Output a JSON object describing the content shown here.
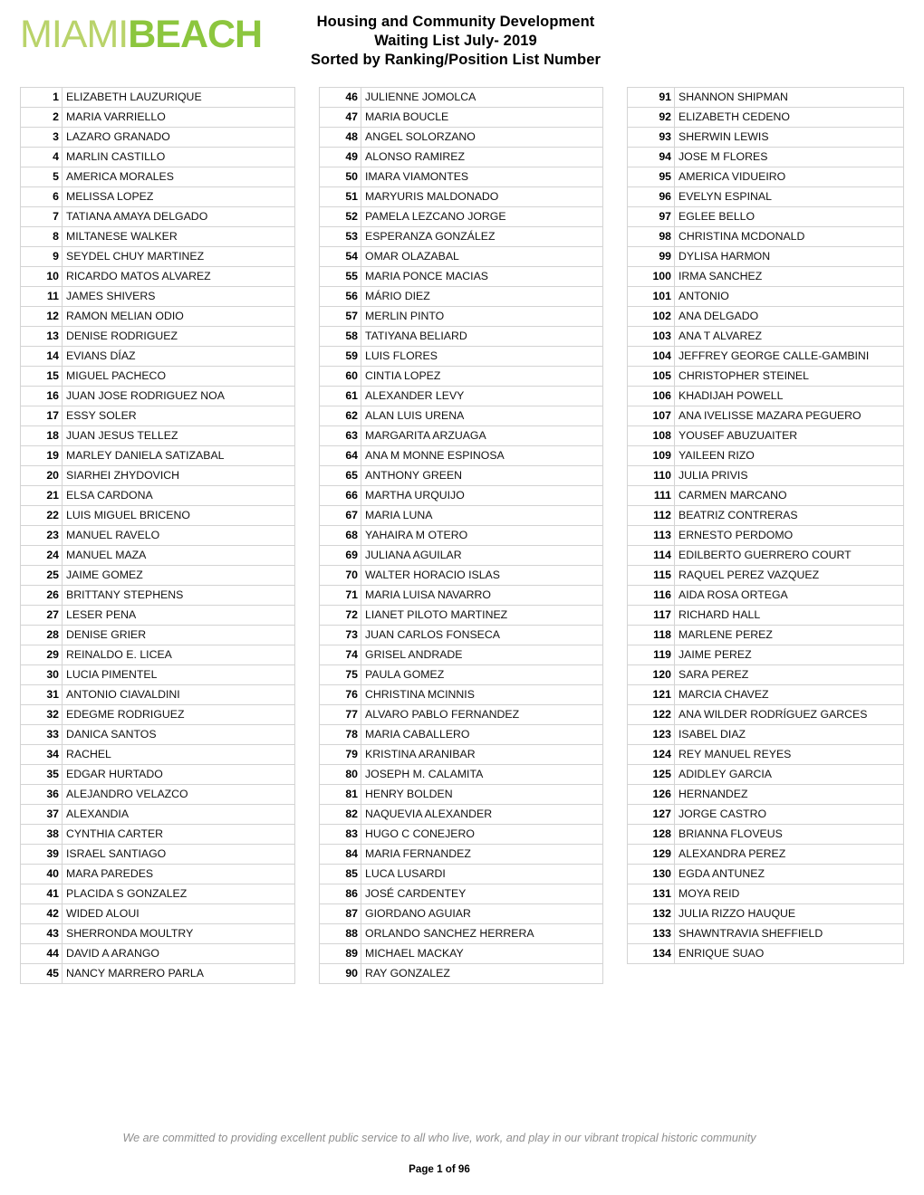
{
  "header": {
    "logo": {
      "part1": "MIAMI",
      "part2": "BEACH",
      "color1": "#b9d36a",
      "color2": "#8cc63e"
    },
    "title_lines": [
      "Housing and Community Development",
      "Waiting List July- 2019",
      "Sorted by Ranking/Position List Number"
    ]
  },
  "footer": {
    "tagline": "We are committed to providing excellent public service to all who live, work, and play in our vibrant tropical historic community",
    "page": "Page 1 of 96"
  },
  "columns": [
    {
      "rows": [
        {
          "num": "1",
          "name": "ELIZABETH LAUZURIQUE"
        },
        {
          "num": "2",
          "name": "MARIA VARRIELLO"
        },
        {
          "num": "3",
          "name": "LAZARO GRANADO"
        },
        {
          "num": "4",
          "name": "MARLIN CASTILLO"
        },
        {
          "num": "5",
          "name": "AMERICA MORALES"
        },
        {
          "num": "6",
          "name": "MELISSA LOPEZ"
        },
        {
          "num": "7",
          "name": "TATIANA AMAYA DELGADO"
        },
        {
          "num": "8",
          "name": "MILTANESE WALKER"
        },
        {
          "num": "9",
          "name": "SEYDEL CHUY MARTINEZ"
        },
        {
          "num": "10",
          "name": "RICARDO MATOS ALVAREZ"
        },
        {
          "num": "11",
          "name": "JAMES SHIVERS"
        },
        {
          "num": "12",
          "name": "RAMON MELIAN ODIO"
        },
        {
          "num": "13",
          "name": "DENISE RODRIGUEZ"
        },
        {
          "num": "14",
          "name": "EVIANS DÍAZ"
        },
        {
          "num": "15",
          "name": "MIGUEL PACHECO"
        },
        {
          "num": "16",
          "name": "JUAN JOSE RODRIGUEZ NOA"
        },
        {
          "num": "17",
          "name": "ESSY SOLER"
        },
        {
          "num": "18",
          "name": "JUAN JESUS TELLEZ"
        },
        {
          "num": "19",
          "name": "MARLEY DANIELA SATIZABAL"
        },
        {
          "num": "20",
          "name": "SIARHEI ZHYDOVICH"
        },
        {
          "num": "21",
          "name": "ELSA CARDONA"
        },
        {
          "num": "22",
          "name": "LUIS MIGUEL BRICENO"
        },
        {
          "num": "23",
          "name": "MANUEL RAVELO"
        },
        {
          "num": "24",
          "name": "MANUEL MAZA"
        },
        {
          "num": "25",
          "name": "JAIME GOMEZ"
        },
        {
          "num": "26",
          "name": "BRITTANY STEPHENS"
        },
        {
          "num": "27",
          "name": "LESER PENA"
        },
        {
          "num": "28",
          "name": "DENISE GRIER"
        },
        {
          "num": "29",
          "name": "REINALDO E. LICEA"
        },
        {
          "num": "30",
          "name": "LUCIA PIMENTEL"
        },
        {
          "num": "31",
          "name": "ANTONIO CIAVALDINI"
        },
        {
          "num": "32",
          "name": "EDEGME RODRIGUEZ"
        },
        {
          "num": "33",
          "name": "DANICA SANTOS"
        },
        {
          "num": "34",
          "name": "RACHEL"
        },
        {
          "num": "35",
          "name": "EDGAR HURTADO"
        },
        {
          "num": "36",
          "name": "ALEJANDRO VELAZCO"
        },
        {
          "num": "37",
          "name": "ALEXANDIA"
        },
        {
          "num": "38",
          "name": "CYNTHIA CARTER"
        },
        {
          "num": "39",
          "name": "ISRAEL SANTIAGO"
        },
        {
          "num": "40",
          "name": "MARA PAREDES"
        },
        {
          "num": "41",
          "name": "PLACIDA S GONZALEZ"
        },
        {
          "num": "42",
          "name": "WIDED ALOUI"
        },
        {
          "num": "43",
          "name": "SHERRONDA MOULTRY"
        },
        {
          "num": "44",
          "name": "DAVID A ARANGO"
        },
        {
          "num": "45",
          "name": "NANCY MARRERO PARLA"
        }
      ]
    },
    {
      "rows": [
        {
          "num": "46",
          "name": "JULIENNE JOMOLCA"
        },
        {
          "num": "47",
          "name": "MARIA BOUCLE"
        },
        {
          "num": "48",
          "name": "ANGEL SOLORZANO"
        },
        {
          "num": "49",
          "name": "ALONSO RAMIREZ"
        },
        {
          "num": "50",
          "name": "IMARA VIAMONTES"
        },
        {
          "num": "51",
          "name": "MARYURIS MALDONADO"
        },
        {
          "num": "52",
          "name": "PAMELA LEZCANO JORGE"
        },
        {
          "num": "53",
          "name": "ESPERANZA GONZÁLEZ"
        },
        {
          "num": "54",
          "name": "OMAR OLAZABAL"
        },
        {
          "num": "55",
          "name": "MARIA PONCE MACIAS"
        },
        {
          "num": "56",
          "name": "MÁRIO DIEZ"
        },
        {
          "num": "57",
          "name": "MERLIN PINTO"
        },
        {
          "num": "58",
          "name": "TATIYANA BELIARD"
        },
        {
          "num": "59",
          "name": "LUIS FLORES"
        },
        {
          "num": "60",
          "name": "CINTIA LOPEZ"
        },
        {
          "num": "61",
          "name": "ALEXANDER LEVY"
        },
        {
          "num": "62",
          "name": "ALAN LUIS URENA"
        },
        {
          "num": "63",
          "name": "MARGARITA ARZUAGA"
        },
        {
          "num": "64",
          "name": "ANA M MONNE ESPINOSA"
        },
        {
          "num": "65",
          "name": "ANTHONY GREEN"
        },
        {
          "num": "66",
          "name": "MARTHA URQUIJO"
        },
        {
          "num": "67",
          "name": "MARIA LUNA"
        },
        {
          "num": "68",
          "name": "YAHAIRA M OTERO"
        },
        {
          "num": "69",
          "name": "JULIANA AGUILAR"
        },
        {
          "num": "70",
          "name": "WALTER HORACIO ISLAS"
        },
        {
          "num": "71",
          "name": "MARIA LUISA NAVARRO"
        },
        {
          "num": "72",
          "name": "LIANET PILOTO MARTINEZ"
        },
        {
          "num": "73",
          "name": "JUAN CARLOS FONSECA"
        },
        {
          "num": "74",
          "name": "GRISEL ANDRADE"
        },
        {
          "num": "75",
          "name": "PAULA GOMEZ"
        },
        {
          "num": "76",
          "name": "CHRISTINA MCINNIS"
        },
        {
          "num": "77",
          "name": "ALVARO PABLO FERNANDEZ"
        },
        {
          "num": "78",
          "name": "MARIA CABALLERO"
        },
        {
          "num": "79",
          "name": "KRISTINA ARANIBAR"
        },
        {
          "num": "80",
          "name": "JOSEPH M. CALAMITA"
        },
        {
          "num": "81",
          "name": "HENRY BOLDEN"
        },
        {
          "num": "82",
          "name": "NAQUEVIA ALEXANDER"
        },
        {
          "num": "83",
          "name": "HUGO C CONEJERO"
        },
        {
          "num": "84",
          "name": "MARIA FERNANDEZ"
        },
        {
          "num": "85",
          "name": "LUCA LUSARDI"
        },
        {
          "num": "86",
          "name": "JOSÉ CARDENTEY"
        },
        {
          "num": "87",
          "name": "GIORDANO AGUIAR"
        },
        {
          "num": "88",
          "name": "ORLANDO SANCHEZ HERRERA"
        },
        {
          "num": "89",
          "name": "MICHAEL MACKAY"
        },
        {
          "num": "90",
          "name": "RAY GONZALEZ"
        }
      ]
    },
    {
      "rows": [
        {
          "num": "91",
          "name": "SHANNON SHIPMAN"
        },
        {
          "num": "92",
          "name": "ELIZABETH CEDENO"
        },
        {
          "num": "93",
          "name": "SHERWIN LEWIS"
        },
        {
          "num": "94",
          "name": "JOSE M FLORES"
        },
        {
          "num": "95",
          "name": "AMERICA VIDUEIRO"
        },
        {
          "num": "96",
          "name": "EVELYN ESPINAL"
        },
        {
          "num": "97",
          "name": "EGLEE BELLO"
        },
        {
          "num": "98",
          "name": "CHRISTINA MCDONALD"
        },
        {
          "num": "99",
          "name": "DYLISA HARMON"
        },
        {
          "num": "100",
          "name": "IRMA SANCHEZ"
        },
        {
          "num": "101",
          "name": "ANTONIO"
        },
        {
          "num": "102",
          "name": "ANA DELGADO"
        },
        {
          "num": "103",
          "name": "ANA T ALVAREZ"
        },
        {
          "num": "104",
          "name": "JEFFREY GEORGE CALLE-GAMBINI"
        },
        {
          "num": "105",
          "name": "CHRISTOPHER STEINEL"
        },
        {
          "num": "106",
          "name": "KHADIJAH POWELL"
        },
        {
          "num": "107",
          "name": "ANA IVELISSE MAZARA PEGUERO"
        },
        {
          "num": "108",
          "name": "YOUSEF ABUZUAITER"
        },
        {
          "num": "109",
          "name": "YAILEEN RIZO"
        },
        {
          "num": "110",
          "name": "JULIA PRIVIS"
        },
        {
          "num": "111",
          "name": "CARMEN MARCANO"
        },
        {
          "num": "112",
          "name": "BEATRIZ CONTRERAS"
        },
        {
          "num": "113",
          "name": "ERNESTO PERDOMO"
        },
        {
          "num": "114",
          "name": "EDILBERTO GUERRERO COURT"
        },
        {
          "num": "115",
          "name": "RAQUEL PEREZ VAZQUEZ"
        },
        {
          "num": "116",
          "name": "AIDA ROSA ORTEGA"
        },
        {
          "num": "117",
          "name": "RICHARD HALL"
        },
        {
          "num": "118",
          "name": "MARLENE PEREZ"
        },
        {
          "num": "119",
          "name": "JAIME PEREZ"
        },
        {
          "num": "120",
          "name": "SARA PEREZ"
        },
        {
          "num": "121",
          "name": "MARCIA CHAVEZ"
        },
        {
          "num": "122",
          "name": "ANA WILDER RODRÍGUEZ GARCES"
        },
        {
          "num": "123",
          "name": "ISABEL DIAZ"
        },
        {
          "num": "124",
          "name": "REY MANUEL REYES"
        },
        {
          "num": "125",
          "name": "ADIDLEY GARCIA"
        },
        {
          "num": "126",
          "name": "HERNANDEZ"
        },
        {
          "num": "127",
          "name": "JORGE CASTRO"
        },
        {
          "num": "128",
          "name": "BRIANNA FLOVEUS"
        },
        {
          "num": "129",
          "name": "ALEXANDRA PEREZ"
        },
        {
          "num": "130",
          "name": "EGDA ANTUNEZ"
        },
        {
          "num": "131",
          "name": "MOYA REID"
        },
        {
          "num": "132",
          "name": "JULIA RIZZO HAUQUE"
        },
        {
          "num": "133",
          "name": "SHAWNTRAVIA SHEFFIELD"
        },
        {
          "num": "134",
          "name": "ENRIQUE SUAO"
        }
      ]
    }
  ]
}
